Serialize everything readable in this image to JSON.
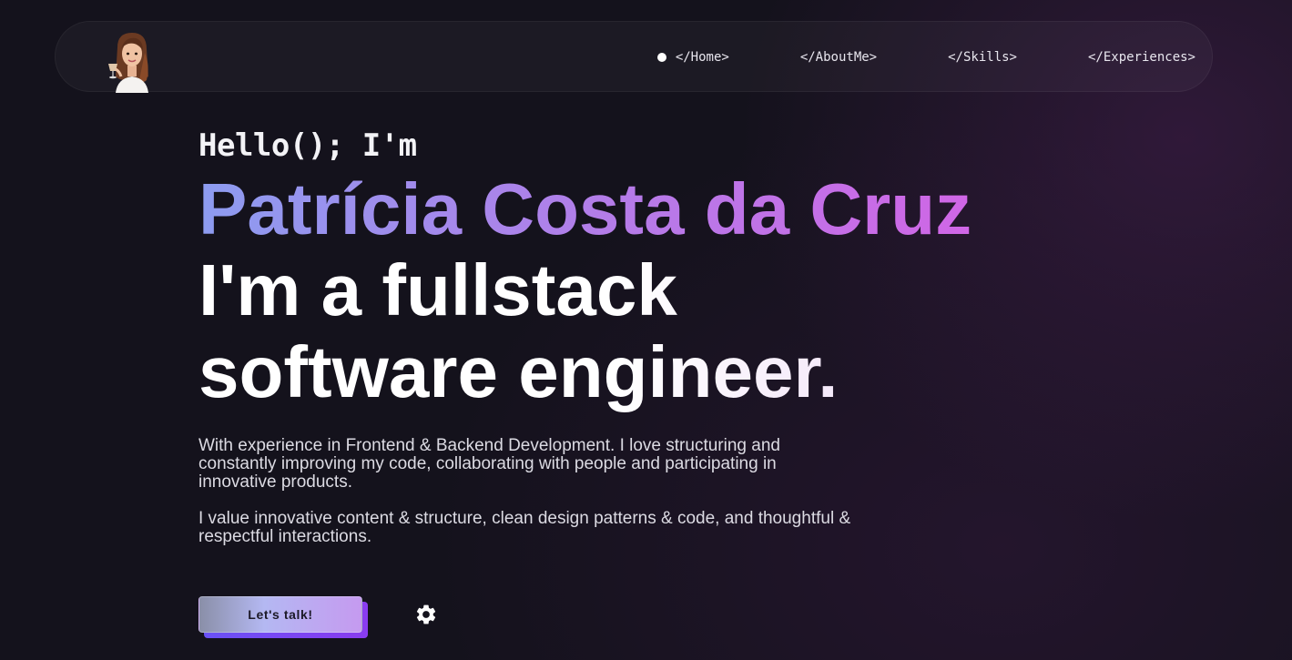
{
  "nav": {
    "items": [
      {
        "label": "</Home>",
        "active": true
      },
      {
        "label": "</AboutMe>",
        "active": false
      },
      {
        "label": "</Skills>",
        "active": false
      },
      {
        "label": "</Experiences>",
        "active": false
      }
    ]
  },
  "hero": {
    "greeting": "Hello(); I'm",
    "name": "Patrícia Costa da Cruz",
    "title": "I'm a fullstack software engineer.",
    "description_1": "With experience in Frontend & Backend Development. I love structuring and constantly improving my code, collaborating with people and participating in innovative products.",
    "description_2": "I value innovative content & structure, clean design patterns & code, and thoughtful & respectful interactions.",
    "cta_label": "Let's talk!"
  },
  "icons": {
    "avatar": "memoji-avatar",
    "settings": "gear-icon"
  },
  "colors": {
    "background": "#14121c",
    "name_gradient_start": "#8d9cf0",
    "name_gradient_end": "#d066e6",
    "cta_shadow": "#7a45f2"
  }
}
